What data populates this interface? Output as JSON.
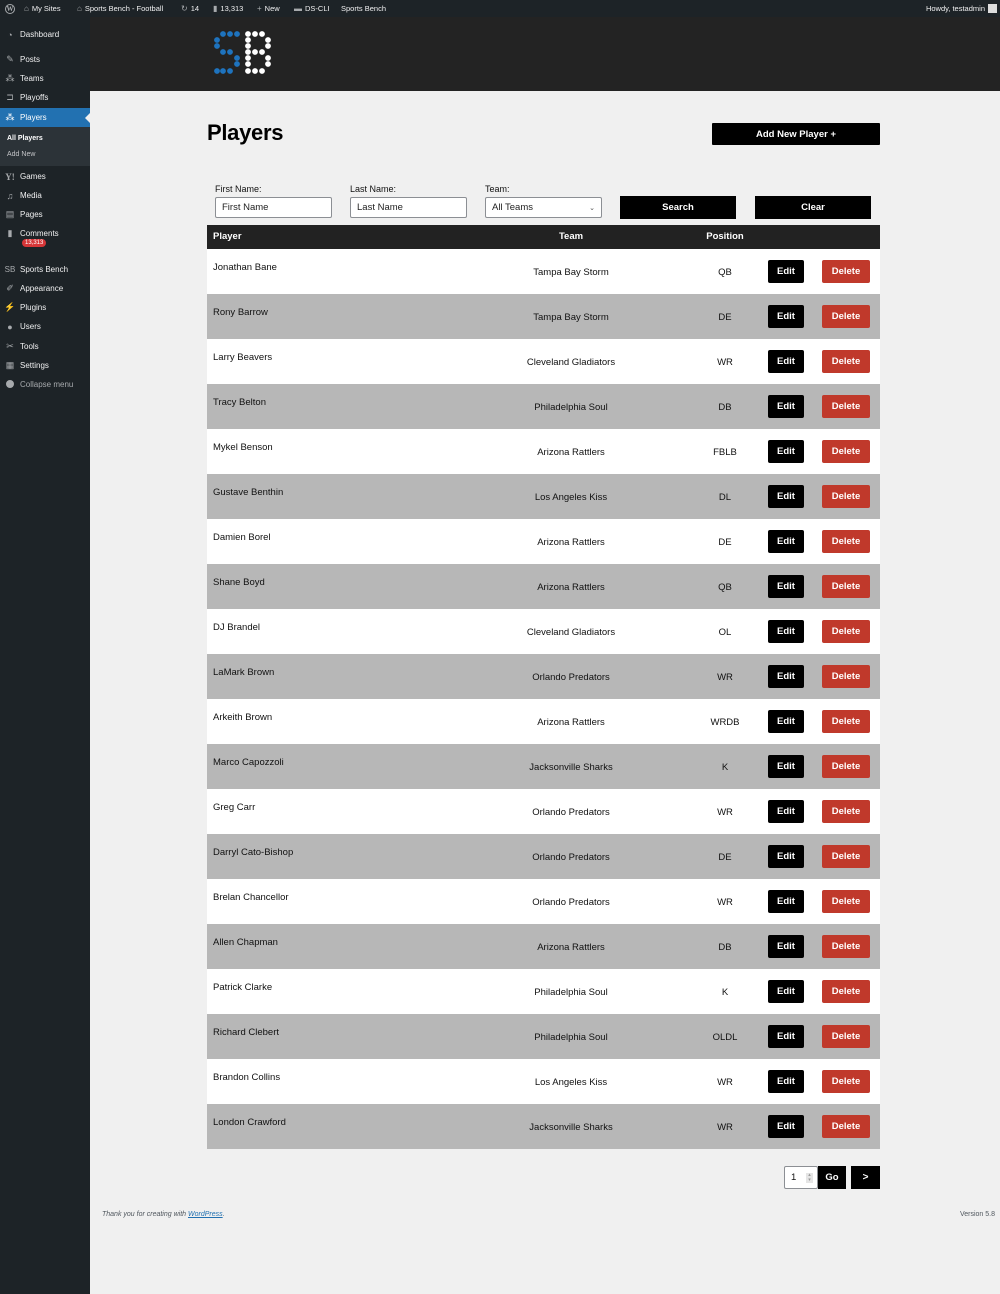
{
  "admin_bar": {
    "my_sites": "My Sites",
    "site_name": "Sports Bench - Football",
    "updates_count": "14",
    "comments_count": "13,313",
    "new_label": "New",
    "ds_cli": "DS-CLI",
    "sports_bench": "Sports Bench",
    "howdy": "Howdy, testadmin"
  },
  "sidebar": {
    "items": [
      {
        "label": "Dashboard",
        "icon": "dashboard-icon"
      },
      {
        "label": "Posts",
        "icon": "pin-icon"
      },
      {
        "label": "Teams",
        "icon": "groups-icon"
      },
      {
        "label": "Playoffs",
        "icon": "bracket-icon"
      },
      {
        "label": "Players",
        "icon": "groups-icon"
      },
      {
        "label": "Games",
        "icon": "yoast-icon"
      },
      {
        "label": "Media",
        "icon": "media-icon"
      },
      {
        "label": "Pages",
        "icon": "pages-icon"
      },
      {
        "label": "Comments",
        "icon": "comment-icon"
      },
      {
        "label": "Sports Bench",
        "icon": "sb-icon"
      },
      {
        "label": "Appearance",
        "icon": "paintbrush-icon"
      },
      {
        "label": "Plugins",
        "icon": "plugin-icon"
      },
      {
        "label": "Users",
        "icon": "user-icon"
      },
      {
        "label": "Tools",
        "icon": "wrench-icon"
      },
      {
        "label": "Settings",
        "icon": "settings-icon"
      }
    ],
    "submenu": [
      "All Players",
      "Add New"
    ],
    "comments_badge": "13,313",
    "collapse_label": "Collapse menu",
    "active_color": "#2271b1"
  },
  "logo": {
    "text": "SB",
    "s_color": "#1e73be",
    "b_color": "#ffffff"
  },
  "page": {
    "title": "Players",
    "add_new_label": "Add New Player +"
  },
  "filters": {
    "first_name_label": "First Name:",
    "first_name_placeholder": "First Name",
    "first_name_value": "",
    "last_name_label": "Last Name:",
    "last_name_placeholder": "Last Name",
    "last_name_value": "",
    "team_label": "Team:",
    "team_selected": "All Teams",
    "search_label": "Search",
    "clear_label": "Clear"
  },
  "table": {
    "headers": {
      "player": "Player",
      "team": "Team",
      "position": "Position"
    },
    "edit_label": "Edit",
    "delete_label": "Delete",
    "delete_color": "#c0392b",
    "rows": [
      {
        "player": "Jonathan Bane",
        "team": "Tampa Bay Storm",
        "position": "QB"
      },
      {
        "player": "Rony Barrow",
        "team": "Tampa Bay Storm",
        "position": "DE"
      },
      {
        "player": "Larry Beavers",
        "team": "Cleveland Gladiators",
        "position": "WR"
      },
      {
        "player": "Tracy Belton",
        "team": "Philadelphia Soul",
        "position": "DB"
      },
      {
        "player": "Mykel Benson",
        "team": "Arizona Rattlers",
        "position": "FBLB"
      },
      {
        "player": "Gustave Benthin",
        "team": "Los Angeles Kiss",
        "position": "DL"
      },
      {
        "player": "Damien Borel",
        "team": "Arizona Rattlers",
        "position": "DE"
      },
      {
        "player": "Shane Boyd",
        "team": "Arizona Rattlers",
        "position": "QB"
      },
      {
        "player": "DJ Brandel",
        "team": "Cleveland Gladiators",
        "position": "OL"
      },
      {
        "player": "LaMark Brown",
        "team": "Orlando Predators",
        "position": "WR"
      },
      {
        "player": "Arkeith Brown",
        "team": "Arizona Rattlers",
        "position": "WRDB"
      },
      {
        "player": "Marco Capozzoli",
        "team": "Jacksonville Sharks",
        "position": "K"
      },
      {
        "player": "Greg Carr",
        "team": "Orlando Predators",
        "position": "WR"
      },
      {
        "player": "Darryl Cato-Bishop",
        "team": "Orlando Predators",
        "position": "DE"
      },
      {
        "player": "Brelan Chancellor",
        "team": "Orlando Predators",
        "position": "WR"
      },
      {
        "player": "Allen Chapman",
        "team": "Arizona Rattlers",
        "position": "DB"
      },
      {
        "player": "Patrick Clarke",
        "team": "Philadelphia Soul",
        "position": "K"
      },
      {
        "player": "Richard Clebert",
        "team": "Philadelphia Soul",
        "position": "OLDL"
      },
      {
        "player": "Brandon Collins",
        "team": "Los Angeles Kiss",
        "position": "WR"
      },
      {
        "player": "London Crawford",
        "team": "Jacksonville Sharks",
        "position": "WR"
      }
    ]
  },
  "pagination": {
    "page_value": "1",
    "go_label": "Go",
    "next_label": ">"
  },
  "footer": {
    "thanks_prefix": "Thank you for creating with ",
    "thanks_link": "WordPress",
    "thanks_suffix": ".",
    "version": "Version 5.8"
  }
}
